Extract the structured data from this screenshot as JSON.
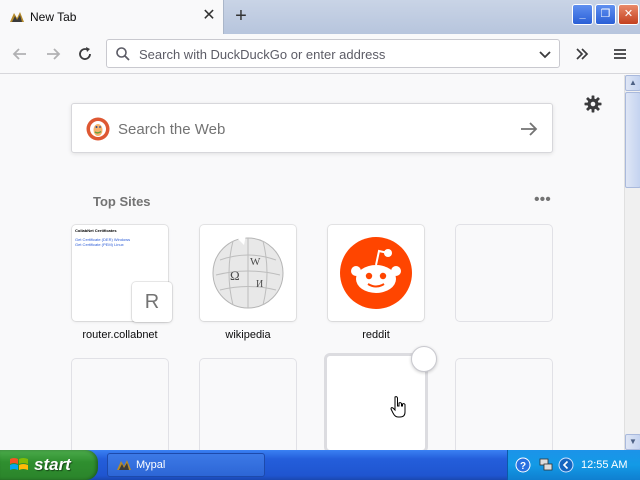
{
  "browser": {
    "tab": {
      "title": "New Tab",
      "favicon": "mypal-icon"
    },
    "window_controls": {
      "min": "minimize-icon",
      "max": "restore-icon",
      "close": "close-icon"
    }
  },
  "navbar": {
    "urlbar": {
      "placeholder": "Search with DuckDuckGo or enter address",
      "value": ""
    }
  },
  "newtab": {
    "search": {
      "placeholder": "Search the Web",
      "engine_icon": "duckduckgo-icon"
    },
    "top_sites": {
      "title": "Top Sites",
      "tiles": [
        {
          "label": "router.collabnet",
          "preview_title": "CollabNet Certificates",
          "preview_links": [
            "Get Certificate (DER) Windows",
            "Get Certificate (PEM) Linux"
          ],
          "badge": "R"
        },
        {
          "label": "wikipedia",
          "icon": "wikipedia-globe-icon"
        },
        {
          "label": "reddit",
          "icon": "reddit-icon",
          "color": "#ff4500"
        },
        {
          "label": ""
        },
        {
          "label": ""
        },
        {
          "label": ""
        },
        {
          "label": ""
        },
        {
          "label": ""
        }
      ]
    }
  },
  "taskbar": {
    "start_label": "start",
    "task": {
      "label": "Mypal",
      "icon": "mypal-icon"
    },
    "clock": "12:55 AM",
    "colors": {
      "taskbar": "#245edb",
      "start": "#2f8f2f",
      "tray": "#139ae6"
    }
  }
}
